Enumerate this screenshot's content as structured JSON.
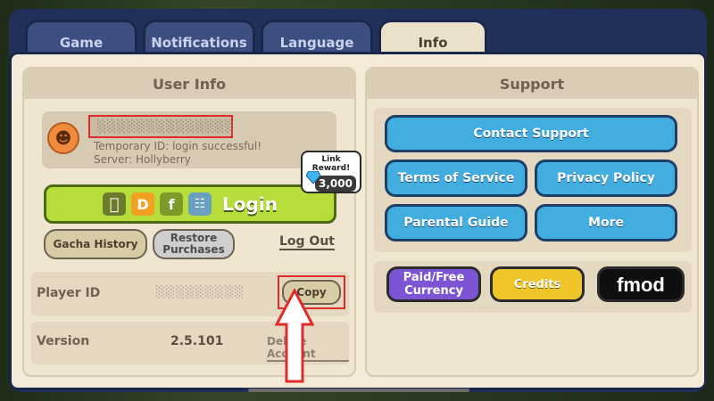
{
  "tabs": [
    {
      "label": "Game"
    },
    {
      "label": "Notifications"
    },
    {
      "label": "Language"
    },
    {
      "label": "Info"
    }
  ],
  "user_info": {
    "title": "User Info",
    "username": "░░░░░░░░░░░░░░",
    "temporary_id": "Temporary ID: login successful!",
    "server": "Server: Hollyberry",
    "link_reward_label": "Link Reward!",
    "link_reward_amount": "3,000",
    "login_label": "Login",
    "login_icons": [
      "D",
      "f"
    ],
    "gacha_history": "Gacha History",
    "restore_purchases": "Restore Purchases",
    "log_out": "Log Out",
    "player_id_label": "Player ID",
    "player_id_value": "░░░░░░░░░",
    "copy_label": "Copy",
    "version_label": "Version",
    "version_value": "2.5.101",
    "delete_account": "Delete Account"
  },
  "support": {
    "title": "Support",
    "contact_support": "Contact Support",
    "terms_of_service": "Terms of Service",
    "privacy_policy": "Privacy Policy",
    "parental_guide": "Parental Guide",
    "more": "More",
    "paid_free_currency": "Paid/Free Currency",
    "credits": "Credits",
    "fmod": "fmod"
  }
}
